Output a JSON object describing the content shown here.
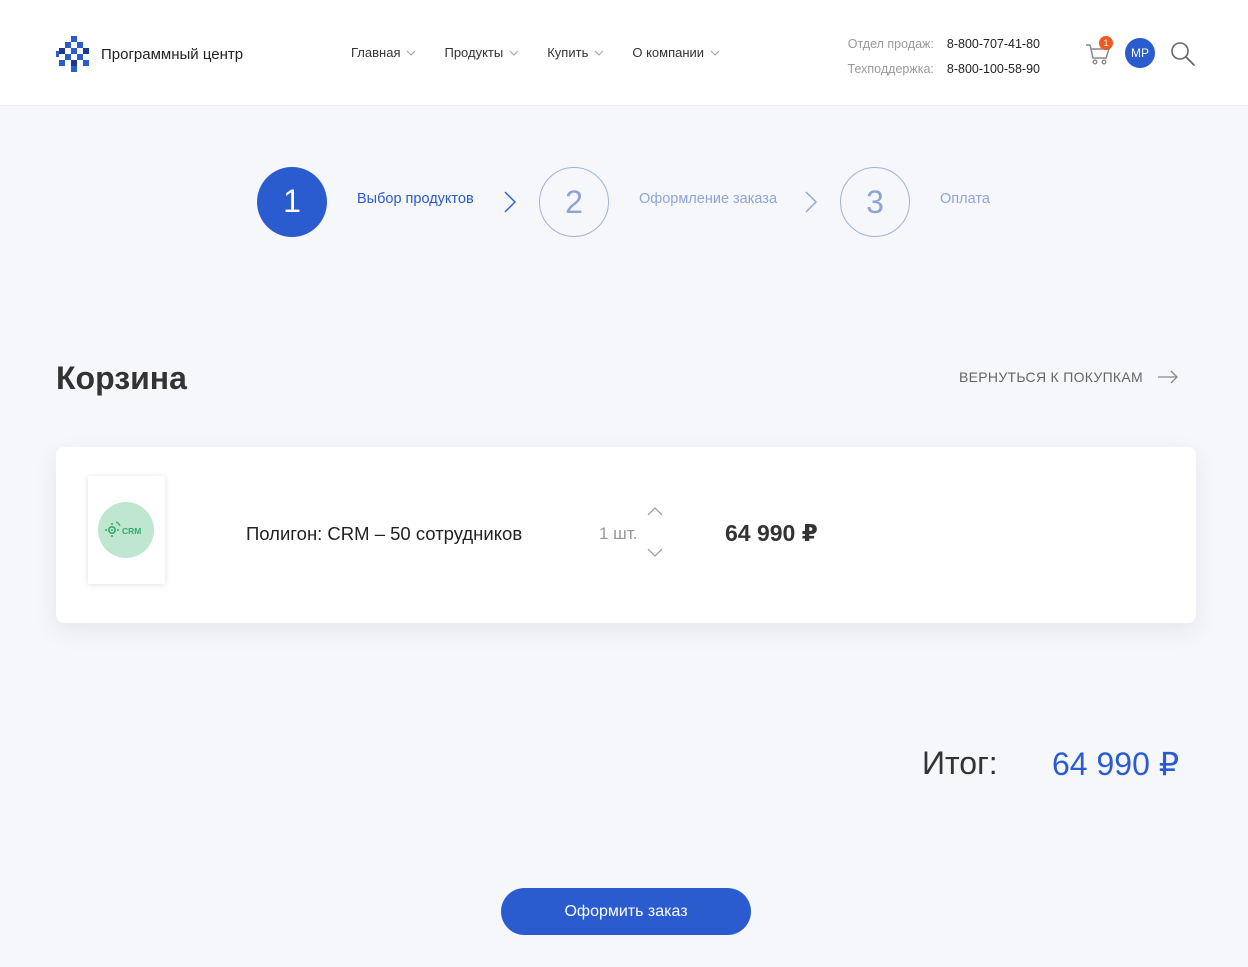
{
  "header": {
    "logo_text": "Программный центр",
    "nav": [
      {
        "label": "Главная"
      },
      {
        "label": "Продукты"
      },
      {
        "label": "Купить"
      },
      {
        "label": "О компании"
      }
    ],
    "contacts": [
      {
        "label": "Отдел продаж:",
        "phone": "8-800-707-41-80"
      },
      {
        "label": "Техподдержка:",
        "phone": "8-800-100-58-90"
      }
    ],
    "cart_count": "1",
    "avatar_initials": "МР",
    "icons": [
      "cart-icon",
      "search-icon",
      "chevron-down-icon"
    ]
  },
  "steps": [
    {
      "number": "1",
      "label": "Выбор продуктов",
      "active": true
    },
    {
      "number": "2",
      "label": "Оформление заказа",
      "active": false
    },
    {
      "number": "3",
      "label": "Оплата",
      "active": false
    }
  ],
  "cart": {
    "title": "Корзина",
    "back_label": "ВЕРНУТЬСЯ К ПОКУПКАМ",
    "items": [
      {
        "logo_text": "CRM",
        "name": "Полигон: CRM – 50 сотрудников",
        "quantity": "1 шт.",
        "price": "64 990 ₽"
      }
    ],
    "total_label": "Итог:",
    "total_value": "64 990 ₽",
    "checkout_label": "Оформить заказ"
  },
  "colors": {
    "accent": "#2a5bcf",
    "badge": "#f05a22",
    "background": "#f6f7fb",
    "step_inactive": "#8fa4d6"
  }
}
